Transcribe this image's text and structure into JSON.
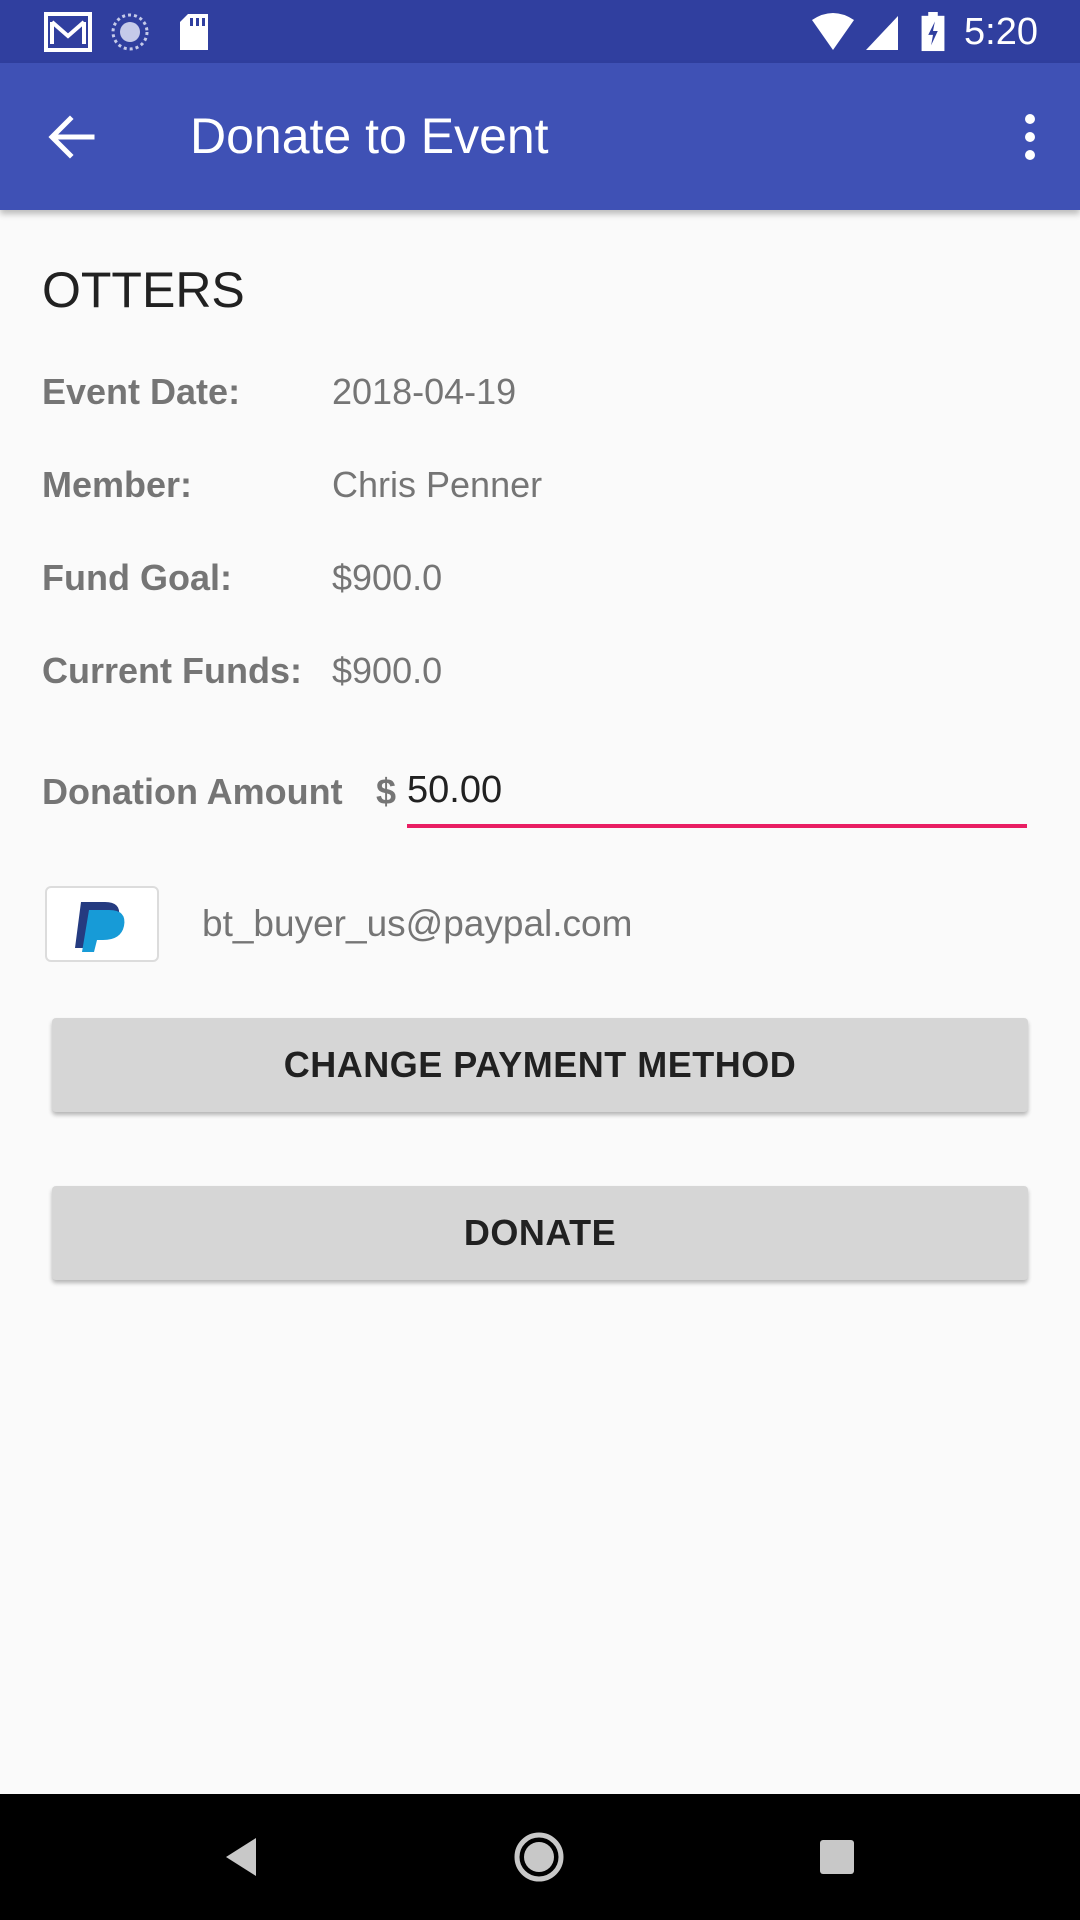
{
  "status_bar": {
    "time": "5:20",
    "left_icons": [
      "gmail-icon",
      "sync-icon",
      "sd-card-icon"
    ],
    "right_icons": [
      "wifi-icon",
      "signal-icon",
      "battery-charging-icon"
    ]
  },
  "app_bar": {
    "title": "Donate to Event",
    "back_icon": "arrow-back-icon",
    "menu_icon": "more-vert-icon",
    "color": "#3f51b5"
  },
  "event": {
    "name": "OTTERS",
    "details": [
      {
        "label": "Event Date:",
        "value": "2018-04-19"
      },
      {
        "label": "Member:",
        "value": "Chris Penner"
      },
      {
        "label": "Fund Goal:",
        "value": "$900.0"
      },
      {
        "label": "Current Funds:",
        "value": "$900.0"
      }
    ]
  },
  "donation": {
    "label": "Donation Amount",
    "currency": "$",
    "amount": "50.00",
    "accent_color": "#e91e63"
  },
  "payment": {
    "logo_icon": "paypal-icon",
    "email": "bt_buyer_us@paypal.com"
  },
  "buttons": {
    "change_payment": "CHANGE PAYMENT METHOD",
    "donate": "DONATE"
  },
  "nav_bar": {
    "icons": [
      "nav-back-icon",
      "nav-home-icon",
      "nav-recents-icon"
    ]
  }
}
